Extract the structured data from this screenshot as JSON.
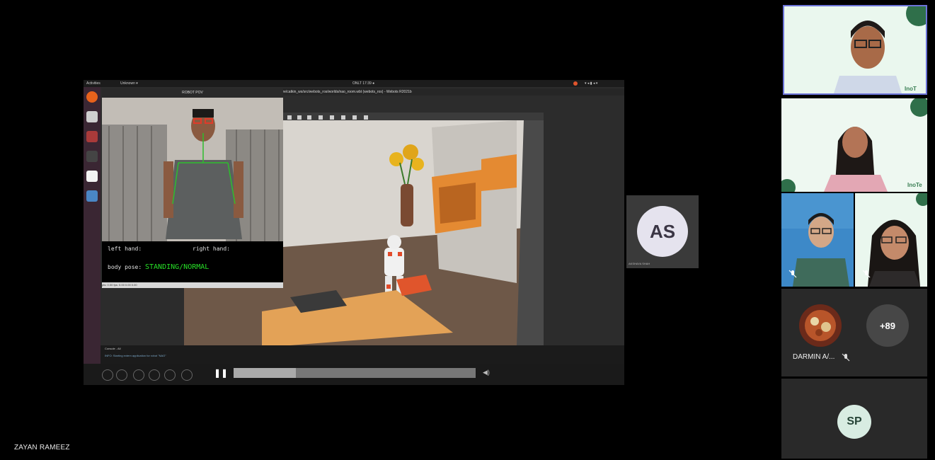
{
  "presenter": {
    "name": "ZAYAN RAMEEZ"
  },
  "desktop": {
    "activities": "Activities",
    "app_menu": "Unknown ▾",
    "clock": "ONLT 17:39 ●",
    "window_title": "/share/catkin_ws/src/webots_ros/worlds/nao_room.wbt (webots_ros) - Webots R2021b",
    "console_label": "Console - All",
    "console_line": "INFO: Starting extern application for robot \"NAO\""
  },
  "pov": {
    "title": "ROBOT POV",
    "left_hand_label": "left hand:",
    "right_hand_label": "right hand:",
    "body_pose_label": "body pose:",
    "body_pose_value": "STANDING/NORMAL",
    "status": "pts: 0.00 fps: 0.00 0.00 0.00"
  },
  "participants": {
    "as_tile": {
      "initials": "AS",
      "label": "AKSHAYA SHAH"
    },
    "tile5": {
      "name": "DARMIN A/...",
      "overflow_count": "+89"
    },
    "tile6": {
      "initials": "SP"
    },
    "inotech_label": "InoT",
    "inotech_label2": "InoTe"
  },
  "colors": {
    "accent_border": "#6c74d8",
    "pose_green": "#27e027",
    "as_avatar_bg": "#e5e3ee",
    "sp_avatar_bg": "#d8ece2"
  }
}
